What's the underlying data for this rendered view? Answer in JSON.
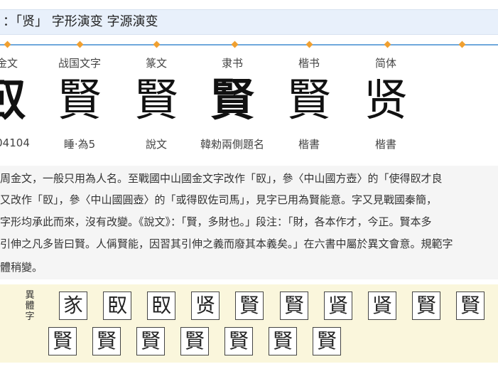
{
  "header": {
    "title_prefix": "：「贤」",
    "title_rest": "字形演变 字源演变"
  },
  "stages": [
    {
      "name": "金文",
      "glyph": "臤",
      "source": "04104"
    },
    {
      "name": "战国文字",
      "glyph": "賢",
      "source": "睡·為5"
    },
    {
      "name": "篆文",
      "glyph": "賢",
      "source": "說文"
    },
    {
      "name": "隶书",
      "glyph": "賢",
      "source": "韓勑兩側題名"
    },
    {
      "name": "楷书",
      "glyph": "賢",
      "source": "楷書"
    },
    {
      "name": "简体",
      "glyph": "贤",
      "source": "楷書"
    }
  ],
  "description": [
    "周金文，一般只用為人名。至戰國中山國金文字改作「臤」，參〈中山國方壺〉的「使得臤才良",
    "又改作「臤」，參〈中山國圓壺〉的「或得臤佐司馬」，見字已用為賢能意。字又見戰國秦簡，",
    "字形均承此而來，沒有改變。《說文》：「賢，多財也。」段注：「財，各本作才，今正。賢本多",
    "引伸之凡多皆曰賢。人偁賢能，因習其引伸之義而廢其本義矣。」在六書中屬於異文會意。規範字",
    "體稍變。"
  ],
  "variants": {
    "label": "異體字",
    "row1": [
      "㒸",
      "臤",
      "臤",
      "贤",
      "賢",
      "賢",
      "䝨",
      "䝨",
      "賢",
      "賢"
    ],
    "row2": [
      "賢",
      "賢",
      "賢",
      "賢",
      "賢",
      "賢",
      "賢"
    ]
  }
}
